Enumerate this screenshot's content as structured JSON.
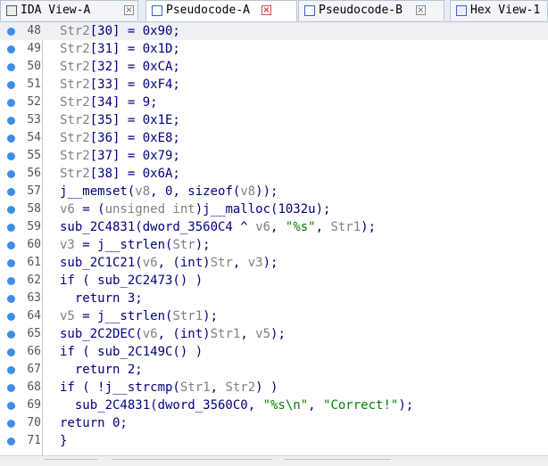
{
  "tabs": [
    {
      "label": "IDA View-A",
      "icon": "graph-icon",
      "close": "×"
    },
    {
      "label": "Pseudocode-A",
      "icon": "pseudocode-icon",
      "close": "×",
      "active": true
    },
    {
      "label": "Pseudocode-B",
      "icon": "pseudocode-icon",
      "close": "×"
    },
    {
      "label": "Hex View-1",
      "icon": "hex-icon"
    }
  ],
  "lines": [
    {
      "n": "48",
      "parts": [
        [
          "gv",
          "Str2"
        ],
        [
          "",
          "[30] = 0x90;"
        ]
      ]
    },
    {
      "n": "49",
      "parts": [
        [
          "gv",
          "Str2"
        ],
        [
          "",
          "[31] = 0x1D;"
        ]
      ]
    },
    {
      "n": "50",
      "parts": [
        [
          "gv",
          "Str2"
        ],
        [
          "",
          "[32] = 0xCA;"
        ]
      ]
    },
    {
      "n": "51",
      "parts": [
        [
          "gv",
          "Str2"
        ],
        [
          "",
          "[33] = 0xF4;"
        ]
      ]
    },
    {
      "n": "52",
      "parts": [
        [
          "gv",
          "Str2"
        ],
        [
          "",
          "[34] = 9;"
        ]
      ]
    },
    {
      "n": "53",
      "parts": [
        [
          "gv",
          "Str2"
        ],
        [
          "",
          "[35] = 0x1E;"
        ]
      ]
    },
    {
      "n": "54",
      "parts": [
        [
          "gv",
          "Str2"
        ],
        [
          "",
          "[36] = 0xE8;"
        ]
      ]
    },
    {
      "n": "55",
      "parts": [
        [
          "gv",
          "Str2"
        ],
        [
          "",
          "[37] = 0x79;"
        ]
      ]
    },
    {
      "n": "56",
      "parts": [
        [
          "gv",
          "Str2"
        ],
        [
          "",
          "[38] = 0x6A;"
        ]
      ]
    },
    {
      "n": "57",
      "parts": [
        [
          "",
          "j__memset("
        ],
        [
          "gv",
          "v8"
        ],
        [
          "",
          ", 0, sizeof("
        ],
        [
          "gv",
          "v8"
        ],
        [
          "",
          "));"
        ]
      ]
    },
    {
      "n": "58",
      "parts": [
        [
          "gv",
          "v6"
        ],
        [
          "",
          " = ("
        ],
        [
          "gv",
          "unsigned int"
        ],
        [
          "",
          ")j__malloc(1032u);"
        ]
      ]
    },
    {
      "n": "59",
      "parts": [
        [
          "",
          "sub_2C4831(dword_3560C4 ^ "
        ],
        [
          "gv",
          "v6"
        ],
        [
          "",
          ", "
        ],
        [
          "str",
          "\"%s\""
        ],
        [
          "",
          ", "
        ],
        [
          "gv",
          "Str1"
        ],
        [
          "",
          ");"
        ]
      ]
    },
    {
      "n": "60",
      "parts": [
        [
          "gv",
          "v3"
        ],
        [
          "",
          " = j__strlen("
        ],
        [
          "gv",
          "Str"
        ],
        [
          "",
          ");"
        ]
      ]
    },
    {
      "n": "61",
      "parts": [
        [
          "",
          "sub_2C1C21("
        ],
        [
          "gv",
          "v6"
        ],
        [
          "",
          ", (int)"
        ],
        [
          "gv",
          "Str"
        ],
        [
          "",
          ", "
        ],
        [
          "gv",
          "v3"
        ],
        [
          "",
          ");"
        ]
      ]
    },
    {
      "n": "62",
      "parts": [
        [
          "",
          "if ( sub_2C2473() )"
        ]
      ]
    },
    {
      "n": "63",
      "parts": [
        [
          "",
          "  return 3;"
        ]
      ]
    },
    {
      "n": "64",
      "parts": [
        [
          "gv",
          "v5"
        ],
        [
          "",
          " = j__strlen("
        ],
        [
          "gv",
          "Str1"
        ],
        [
          "",
          ");"
        ]
      ]
    },
    {
      "n": "65",
      "parts": [
        [
          "",
          "sub_2C2DEC("
        ],
        [
          "gv",
          "v6"
        ],
        [
          "",
          ", (int)"
        ],
        [
          "gv",
          "Str1"
        ],
        [
          "",
          ", "
        ],
        [
          "gv",
          "v5"
        ],
        [
          "",
          ");"
        ]
      ]
    },
    {
      "n": "66",
      "parts": [
        [
          "",
          "if ( sub_2C149C() )"
        ]
      ]
    },
    {
      "n": "67",
      "parts": [
        [
          "",
          "  return 2;"
        ]
      ]
    },
    {
      "n": "68",
      "parts": [
        [
          "",
          "if ( !j__strcmp("
        ],
        [
          "gv",
          "Str1"
        ],
        [
          "",
          ", "
        ],
        [
          "gv",
          "Str2"
        ],
        [
          "",
          ") )"
        ]
      ]
    },
    {
      "n": "69",
      "parts": [
        [
          "",
          "  sub_2C4831(dword_3560C0, "
        ],
        [
          "str",
          "\"%s\\n\""
        ],
        [
          "",
          ", "
        ],
        [
          "str",
          "\"Correct!\""
        ],
        [
          "",
          ");"
        ]
      ]
    },
    {
      "n": "70",
      "parts": [
        [
          "",
          "return 0;"
        ]
      ]
    },
    {
      "n": "71",
      "parts": [
        [
          "",
          "}"
        ]
      ]
    }
  ],
  "colors": {
    "accent": "#3e8ee6",
    "code": "#000080",
    "var": "#808080",
    "string": "#008000"
  }
}
